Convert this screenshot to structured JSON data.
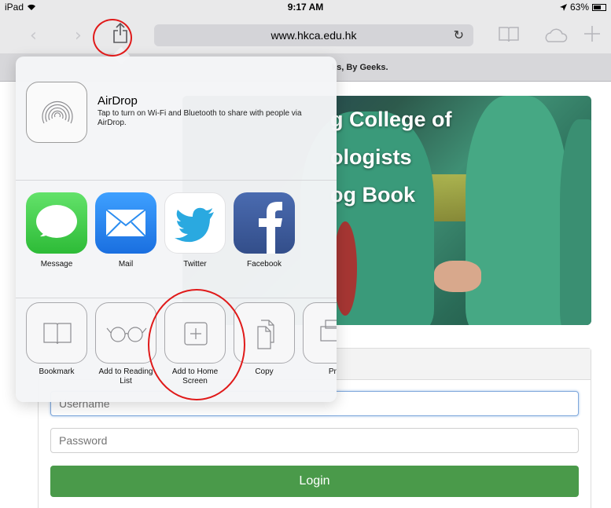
{
  "status_bar": {
    "device": "iPad",
    "time": "9:17 AM",
    "battery_percent": "63%",
    "battery_level": 0.63
  },
  "toolbar": {
    "url": "www.hkca.edu.hk",
    "icons": [
      "back-arrow-icon",
      "forward-arrow-icon",
      "share-icon",
      "reload-icon",
      "bookmarks-book-icon",
      "icloud-tabs-icon",
      "new-tab-plus-icon"
    ]
  },
  "tab_title": "ks, By Geeks.",
  "hero": {
    "lines": [
      "g College of",
      "ologists",
      "og Book"
    ]
  },
  "login": {
    "username_placeholder": "Username",
    "password_placeholder": "Password",
    "button_label": "Login"
  },
  "share_sheet": {
    "airdrop": {
      "title": "AirDrop",
      "description": "Tap to turn on Wi-Fi and Bluetooth to share with people via AirDrop."
    },
    "apps": [
      {
        "label": "Message",
        "color": "#3fcf4b"
      },
      {
        "label": "Mail",
        "color": "#2a8cf0"
      },
      {
        "label": "Twitter",
        "color": "#2aa9e0"
      },
      {
        "label": "Facebook",
        "color": "#3b5a9a"
      }
    ],
    "actions": [
      {
        "label": "Bookmark"
      },
      {
        "label": "Add to Reading List"
      },
      {
        "label": "Add to Home Screen"
      },
      {
        "label": "Copy"
      },
      {
        "label": "Pri"
      }
    ]
  },
  "annotation_color": "#e01a1a"
}
